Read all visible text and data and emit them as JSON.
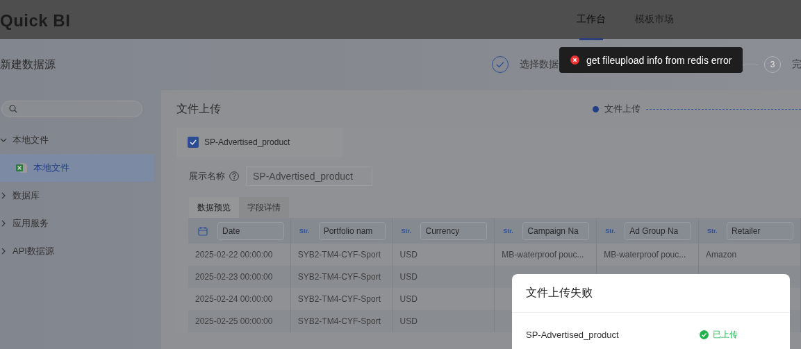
{
  "header": {
    "logo": "Quick BI",
    "nav": [
      {
        "label": "工作台",
        "selected": true
      },
      {
        "label": "模板市场",
        "selected": false
      }
    ]
  },
  "page_title": "新建数据源",
  "steps": [
    {
      "label": "选择数据"
    },
    {
      "number": "3",
      "label": "完"
    }
  ],
  "toast": {
    "message": "get fileupload info from redis error"
  },
  "sidebar": {
    "items": [
      {
        "label": "本地文件",
        "expanded": true,
        "children": [
          {
            "label": "本地文件",
            "selected": true
          }
        ]
      },
      {
        "label": "数据库",
        "expanded": false
      },
      {
        "label": "应用服务",
        "expanded": false
      },
      {
        "label": "API数据源",
        "expanded": false
      }
    ]
  },
  "upload": {
    "title": "文件上传",
    "progress_step": "文件上传",
    "files": [
      {
        "name": "SP-Advertised_product",
        "checked": true
      }
    ],
    "display_name_label": "展示名称",
    "display_name_value": "SP-Advertised_product",
    "tabs": [
      {
        "label": "数据预览",
        "selected": true
      },
      {
        "label": "字段详情",
        "selected": false
      }
    ],
    "table": {
      "columns": [
        {
          "name": "Date"
        },
        {
          "type_label": "Str.",
          "name": "Portfolio nam"
        },
        {
          "type_label": "Str.",
          "name": "Currency"
        },
        {
          "type_label": "Str.",
          "name": "Campaign Na"
        },
        {
          "type_label": "Str.",
          "name": "Ad Group Na"
        },
        {
          "type_label": "Str.",
          "name": "Retailer"
        }
      ],
      "rows": [
        [
          "2025-02-22 00:00:00",
          "SYB2-TM4-CYF-Sport",
          "USD",
          "MB-waterproof pouc...",
          "MB-waterproof pouc...",
          "Amazon"
        ],
        [
          "2025-02-23 00:00:00",
          "SYB2-TM4-CYF-Sport",
          "USD"
        ],
        [
          "2025-02-24 00:00:00",
          "SYB2-TM4-CYF-Sport",
          "USD"
        ],
        [
          "2025-02-25 00:00:00",
          "SYB2-TM4-CYF-Sport",
          "USD"
        ]
      ]
    }
  },
  "modal": {
    "title": "文件上传失败",
    "files": [
      {
        "name": "SP-Advertised_product",
        "status": "已上传",
        "kind": "success"
      }
    ]
  }
}
